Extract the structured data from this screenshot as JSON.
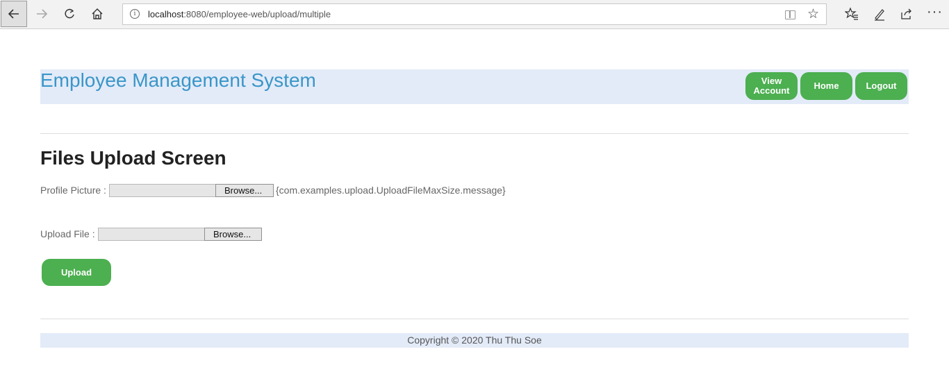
{
  "browser": {
    "url_host": "localhost",
    "url_rest": ":8080/employee-web/upload/multiple",
    "icons": {
      "back": "back-arrow-icon",
      "forward": "forward-arrow-icon",
      "refresh": "refresh-icon",
      "home": "home-icon",
      "info": "info-icon",
      "reader": "reading-view-icon",
      "favorite": "star-icon",
      "favorites_hub": "favorites-hub-icon",
      "notes": "pen-icon",
      "share": "share-icon",
      "more": "more-icon"
    }
  },
  "header": {
    "title": "Employee Management System",
    "nav": [
      {
        "label_line1": "View",
        "label_line2": "Account"
      },
      {
        "label": "Home"
      },
      {
        "label": "Logout"
      }
    ]
  },
  "main": {
    "heading": "Files Upload Screen",
    "profile_label": "Profile Picture :",
    "profile_browse": "Browse...",
    "profile_message": "{com.examples.upload.UploadFileMaxSize.message}",
    "file_label": "Upload File :",
    "file_browse": "Browse...",
    "upload_button": "Upload"
  },
  "footer": {
    "copyright": "Copyright © 2020 Thu Thu Soe"
  },
  "colors": {
    "accent_green": "#4caf50",
    "title_blue": "#3a96c8",
    "band_bg": "#e3ebf8"
  }
}
